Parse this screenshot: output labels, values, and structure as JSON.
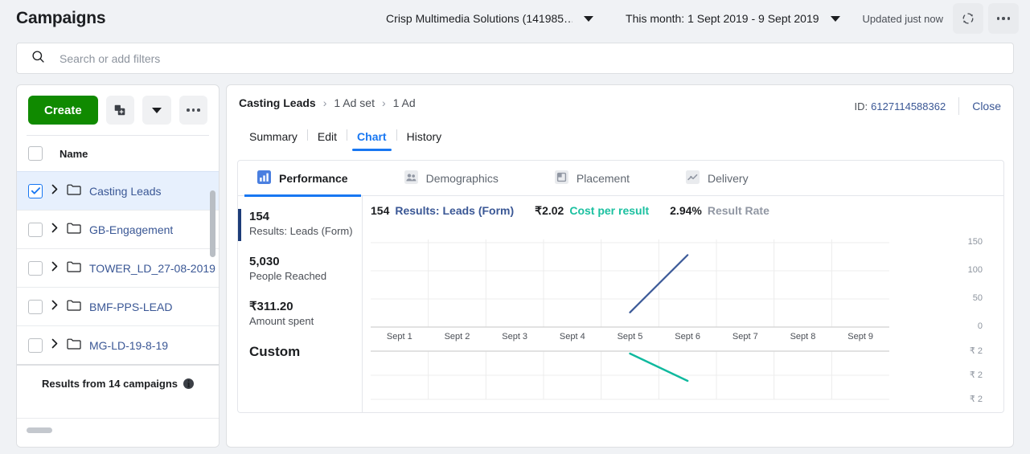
{
  "header": {
    "title": "Campaigns",
    "account": "Crisp Multimedia Solutions (141985…",
    "date_range": "This month: 1 Sept 2019 - 9 Sept 2019",
    "updated": "Updated just now",
    "refresh_icon": "refresh-icon",
    "more_icon": "more-horizontal-icon"
  },
  "search": {
    "placeholder": "Search or add filters",
    "value": "",
    "icon": "search-icon"
  },
  "sidebar": {
    "create_label": "Create",
    "duplicate_icon": "duplicate-icon",
    "dropdown_icon": "chevron-down-icon",
    "more_icon": "more-horizontal-icon",
    "column_header": "Name",
    "items": [
      {
        "label": "Casting Leads",
        "checked": true,
        "selected": true
      },
      {
        "label": "GB-Engagement",
        "checked": false,
        "selected": false
      },
      {
        "label": "TOWER_LD_27-08-2019",
        "checked": false,
        "selected": false
      },
      {
        "label": "BMF-PPS-LEAD",
        "checked": false,
        "selected": false
      },
      {
        "label": "MG-LD-19-8-19",
        "checked": false,
        "selected": false
      }
    ],
    "footer_text": "Results from 14 campaigns",
    "footer_info_icon": "info-icon"
  },
  "detail": {
    "breadcrumb": [
      {
        "label": "Casting Leads",
        "strong": true
      },
      {
        "label": "1 Ad set",
        "strong": false
      },
      {
        "label": "1 Ad",
        "strong": false
      }
    ],
    "breadcrumb_sep": "›",
    "id_label": "ID:",
    "id_value": "6127114588362",
    "close_label": "Close",
    "tabs": [
      {
        "label": "Summary",
        "active": false
      },
      {
        "label": "Edit",
        "active": false
      },
      {
        "label": "Chart",
        "active": true
      },
      {
        "label": "History",
        "active": false
      }
    ],
    "inner_tabs": [
      {
        "label": "Performance",
        "icon": "bar-chart-icon",
        "active": true
      },
      {
        "label": "Demographics",
        "icon": "people-icon",
        "active": false
      },
      {
        "label": "Placement",
        "icon": "placement-icon",
        "active": false
      },
      {
        "label": "Delivery",
        "icon": "line-chart-icon",
        "active": false
      }
    ],
    "metrics": [
      {
        "value": "154",
        "label": "Results: Leads (Form)"
      },
      {
        "value": "5,030",
        "label": "People Reached"
      },
      {
        "value": "₹311.20",
        "label": "Amount spent"
      }
    ],
    "custom_label": "Custom",
    "stats": [
      {
        "value": "154",
        "label": "Results: Leads (Form)",
        "color": "blue"
      },
      {
        "value": "₹2.02",
        "label": "Cost per result",
        "color": "green"
      },
      {
        "value": "2.94%",
        "label": "Result Rate",
        "color": "gray"
      }
    ]
  },
  "chart_data": {
    "type": "line",
    "title": "",
    "xlabel": "",
    "categories": [
      "Sept 1",
      "Sept 2",
      "Sept 3",
      "Sept 4",
      "Sept 5",
      "Sept 6",
      "Sept 7",
      "Sept 8",
      "Sept 9"
    ],
    "panels": [
      {
        "name": "results",
        "ylabel": "Results",
        "ytick_labels": [
          "150",
          "100",
          "50",
          "0"
        ],
        "ytick_values": [
          150,
          100,
          50,
          0
        ],
        "ylim": [
          0,
          150
        ],
        "series": [
          {
            "name": "Results: Leads (Form)",
            "color": "#3b5998",
            "points": [
              {
                "x": "Sept 5",
                "y": 26
              },
              {
                "x": "Sept 6",
                "y": 128
              }
            ]
          }
        ]
      },
      {
        "name": "cost_per_result",
        "ylabel": "Cost per result",
        "ytick_labels": [
          "₹ 2",
          "₹ 2",
          "₹ 2"
        ],
        "series": [
          {
            "name": "Cost per result",
            "color": "#0fb99e",
            "points": [
              {
                "x": "Sept 5",
                "y": 1.0
              },
              {
                "x": "Sept 6",
                "y": 0.35
              }
            ]
          }
        ]
      }
    ],
    "grid": true,
    "legend_position": "top"
  },
  "colors": {
    "accent": "#1877f2",
    "create_green": "#108a00",
    "line_blue": "#3b5998",
    "line_teal": "#0fb99e",
    "link": "#3a5795"
  }
}
